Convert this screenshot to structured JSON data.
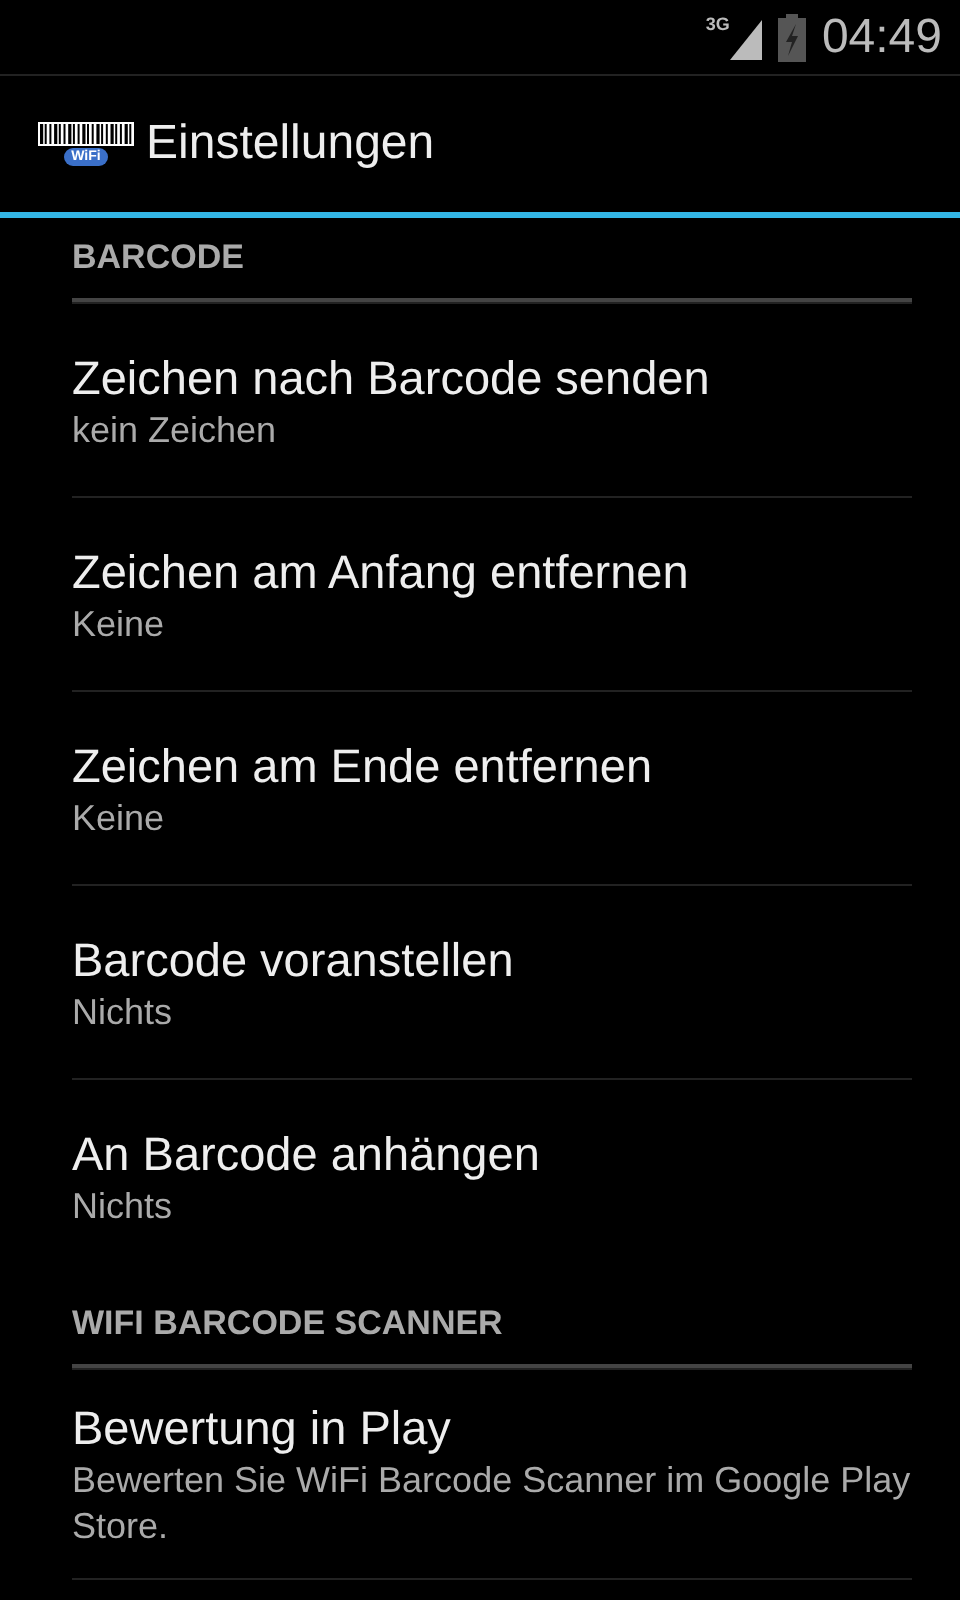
{
  "status_bar": {
    "network": "3G",
    "time": "04:49"
  },
  "action_bar": {
    "app_icon_label": "WiFi",
    "title": "Einstellungen"
  },
  "sections": [
    {
      "header": "BARCODE",
      "items": [
        {
          "title": "Zeichen nach Barcode senden",
          "summary": "kein Zeichen"
        },
        {
          "title": "Zeichen am Anfang entfernen",
          "summary": "Keine"
        },
        {
          "title": "Zeichen am Ende entfernen",
          "summary": "Keine"
        },
        {
          "title": "Barcode voranstellen",
          "summary": "Nichts"
        },
        {
          "title": "An Barcode anhängen",
          "summary": "Nichts"
        }
      ]
    },
    {
      "header": "WIFI BARCODE SCANNER",
      "items": [
        {
          "title": "Bewertung in Play",
          "summary": "Bewerten Sie WiFi Barcode Scanner im Google Play Store."
        }
      ]
    }
  ]
}
